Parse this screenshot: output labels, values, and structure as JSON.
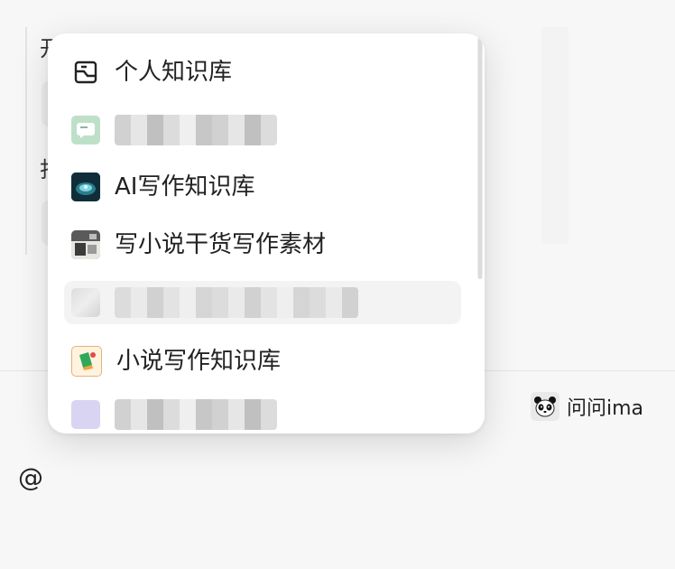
{
  "popup": {
    "items": [
      {
        "label": "个人知识库",
        "icon": "knowledge-base-outline-icon"
      },
      {
        "label": "",
        "icon": "chat-bubble-icon",
        "obscured": true
      },
      {
        "label": "AI写作知识库",
        "icon": "ai-writing-cover-icon"
      },
      {
        "label": "写小说干货写作素材",
        "icon": "novel-cover-icon"
      },
      {
        "label": "",
        "icon": "",
        "obscured": true
      },
      {
        "label": "小说写作知识库",
        "icon": "novel-knowledge-cover-icon"
      },
      {
        "label": "",
        "icon": "",
        "obscured": true
      }
    ]
  },
  "footer": {
    "ask_label": "问问ima",
    "ask_icon": "panda-icon"
  },
  "input": {
    "value": "@"
  },
  "colors": {
    "popup_bg": "#ffffff",
    "hover_bg": "#f3f3f3",
    "text": "#222222",
    "page_bg": "#f7f7f7"
  }
}
